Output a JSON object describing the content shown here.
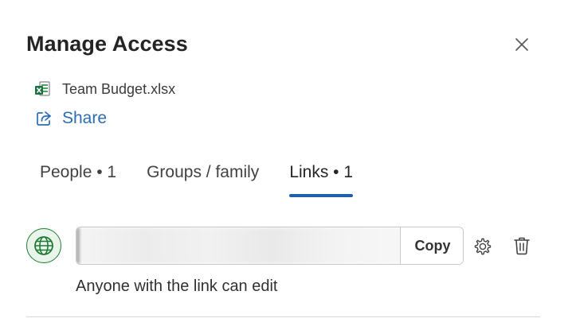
{
  "dialog": {
    "title": "Manage Access"
  },
  "file": {
    "name": "Team Budget.xlsx",
    "icon": "excel-file-icon"
  },
  "share": {
    "label": "Share",
    "icon": "share-icon",
    "color": "#2a6db5"
  },
  "tabs": [
    {
      "label": "People • 1",
      "active": false
    },
    {
      "label": "Groups / family",
      "active": false
    },
    {
      "label": "Links • 1",
      "active": true
    }
  ],
  "link": {
    "icon": "globe-icon",
    "copy_label": "Copy",
    "permission_text": "Anyone with the link can edit",
    "settings_icon": "gear-icon",
    "delete_icon": "trash-icon"
  },
  "colors": {
    "accent": "#1f5fa8",
    "globe": "#1e7a34"
  }
}
